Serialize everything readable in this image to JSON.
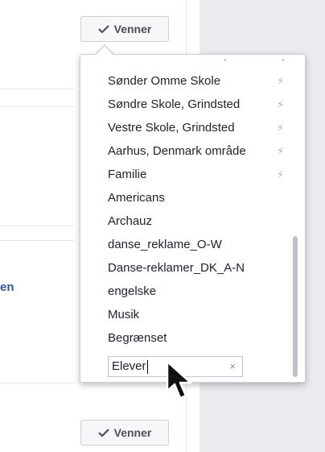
{
  "buttons": {
    "friends_label": "Venner"
  },
  "left_panel": {
    "link_fragment": "en"
  },
  "dropdown": {
    "items": [
      {
        "label": "Sønder Omme Skole",
        "bolt": "⚡"
      },
      {
        "label": "Søndre Skole, Grindsted",
        "bolt": "⚡"
      },
      {
        "label": "Vestre Skole, Grindsted",
        "bolt": "⚡"
      },
      {
        "label": "Aarhus, Denmark område",
        "bolt": "⚡"
      },
      {
        "label": "Familie",
        "bolt": "⚡"
      },
      {
        "label": "Americans"
      },
      {
        "label": "Archauz"
      },
      {
        "label": "danse_reklame_O-W"
      },
      {
        "label": "Danse-reklamer_DK_A-N"
      },
      {
        "label": "engelske"
      },
      {
        "label": "Musik"
      },
      {
        "label": "Begrænset"
      }
    ],
    "search": {
      "value": "Elever",
      "clear_label": "×"
    }
  }
}
